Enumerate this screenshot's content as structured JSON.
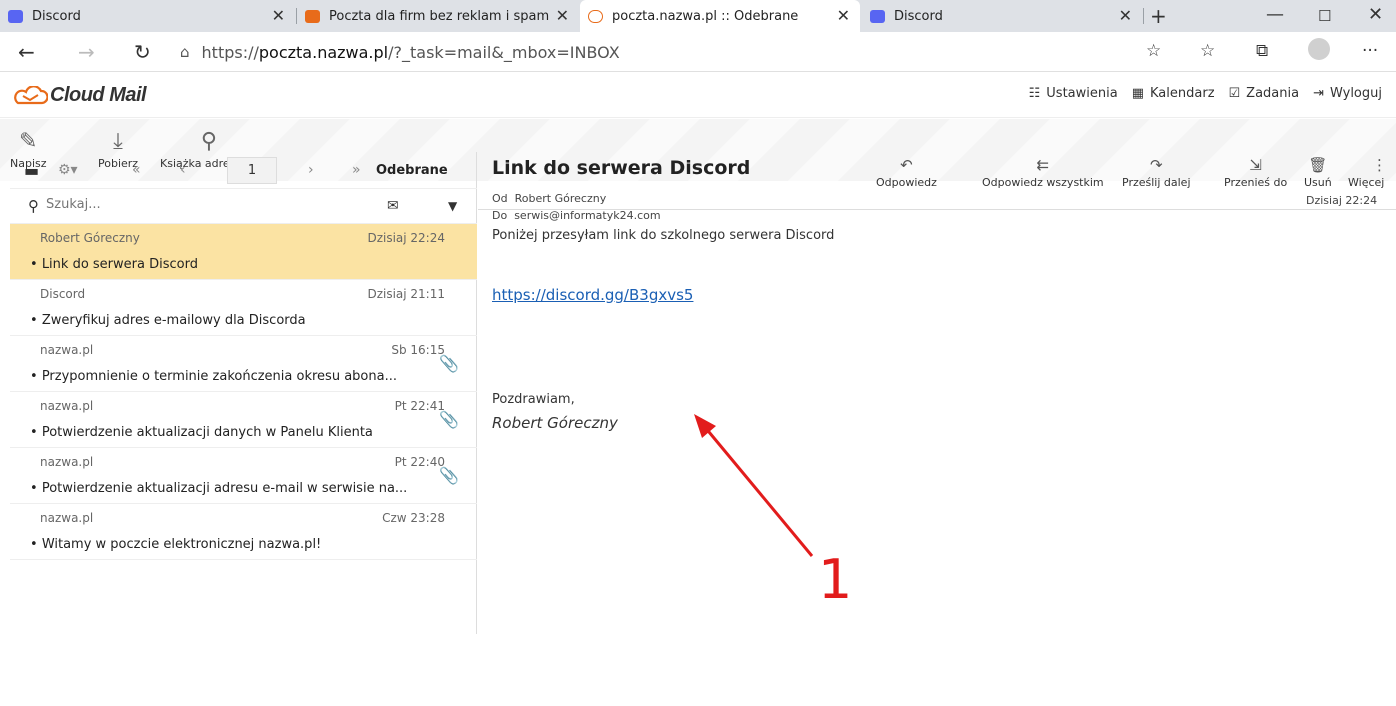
{
  "browser": {
    "tabs": [
      {
        "title": "Discord",
        "favicon": "discord-favicon"
      },
      {
        "title": "Poczta dla firm bez reklam i spam",
        "favicon": "nazwa-favicon"
      },
      {
        "title": "poczta.nazwa.pl :: Odebrane",
        "favicon": "cloud-favicon"
      },
      {
        "title": "Discord",
        "favicon": "discord-favicon"
      }
    ],
    "url_prefix": "https://",
    "url_host": "poczta.nazwa.pl",
    "url_path": "/?_task=mail&_mbox=INBOX"
  },
  "app": {
    "logo_text": "Cloud Mail",
    "menu": {
      "settings": "Ustawienia",
      "calendar": "Kalendarz",
      "tasks": "Zadania",
      "logout": "Wyloguj"
    },
    "toolbar": {
      "compose": "Napisz",
      "fetch": "Pobierz",
      "addressbook": "Książka adresowa"
    },
    "list": {
      "page": "1",
      "folder": "Odebrane",
      "search_placeholder": "Szukaj...",
      "messages": [
        {
          "from": "Robert Góreczny",
          "date": "Dzisiaj 22:24",
          "subject": "Link do serwera Discord"
        },
        {
          "from": "Discord",
          "date": "Dzisiaj 21:11",
          "subject": "Zweryfikuj adres e-mailowy dla Discorda"
        },
        {
          "from": "nazwa.pl",
          "date": "Sb 16:15",
          "subject": "Przypomnienie o terminie zakończenia okresu abona..."
        },
        {
          "from": "nazwa.pl",
          "date": "Pt 22:41",
          "subject": "Potwierdzenie aktualizacji danych w Panelu Klienta"
        },
        {
          "from": "nazwa.pl",
          "date": "Pt 22:40",
          "subject": "Potwierdzenie aktualizacji adresu e-mail w serwisie na..."
        },
        {
          "from": "nazwa.pl",
          "date": "Czw 23:28",
          "subject": "Witamy w poczcie elektronicznej nazwa.pl!"
        }
      ]
    },
    "reader": {
      "title": "Link do serwera Discord",
      "from_label": "Od",
      "from": "Robert Góreczny",
      "to_label": "Do",
      "to": "serwis@informatyk24.com",
      "date": "Dzisiaj 22:24",
      "actions": {
        "reply": "Odpowiedz",
        "reply_all": "Odpowiedz wszystkim",
        "forward": "Prześlij dalej",
        "move": "Przenieś do",
        "delete": "Usuń",
        "more": "Więcej"
      },
      "body": "Poniżej przesyłam link do szkolnego serwera Discord",
      "link": "https://discord.gg/B3gxvs5",
      "greeting": "Pozdrawiam,",
      "signature": "Robert Góreczny"
    }
  },
  "annotation": {
    "label": "1",
    "color": "#e21c1c"
  }
}
